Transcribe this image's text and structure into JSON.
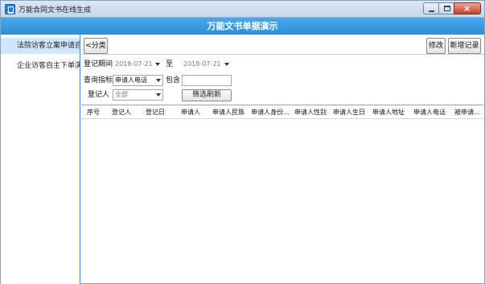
{
  "window": {
    "title": "万能合同文书在线生成"
  },
  "header": {
    "title": "万能文书单据演示"
  },
  "sidebar": {
    "items": [
      {
        "label": "法院访客立案申请自主"
      },
      {
        "label": "企业访客自主下单演示"
      }
    ]
  },
  "toolbar": {
    "category_label": "<分类",
    "edit_label": "修改",
    "add_label": "新增记录"
  },
  "filters": {
    "date_label": "登记期间",
    "date_from": "2018-07-21",
    "to_label": "至",
    "date_to": "2018-07-21",
    "query_label": "查询指标",
    "query_field": "申请人电话",
    "contains_label": "包含",
    "contains_value": "",
    "registrar_label": "登记人",
    "registrar_value": "全部",
    "refresh_label": "筛选刷新"
  },
  "grid": {
    "columns": [
      "序号",
      "登记人",
      "登记日",
      "申请人",
      "申请人民族",
      "申请人身份...",
      "申请人性别",
      "申请人生日",
      "申请人地址",
      "申请人电话",
      "被申请..."
    ]
  },
  "colors": {
    "accent": "#2f8fd6",
    "selected": "#cfe6fb"
  },
  "icons": [
    "app-icon",
    "minimize-icon",
    "maximize-icon",
    "close-icon",
    "dropdown-arrow-icon"
  ]
}
